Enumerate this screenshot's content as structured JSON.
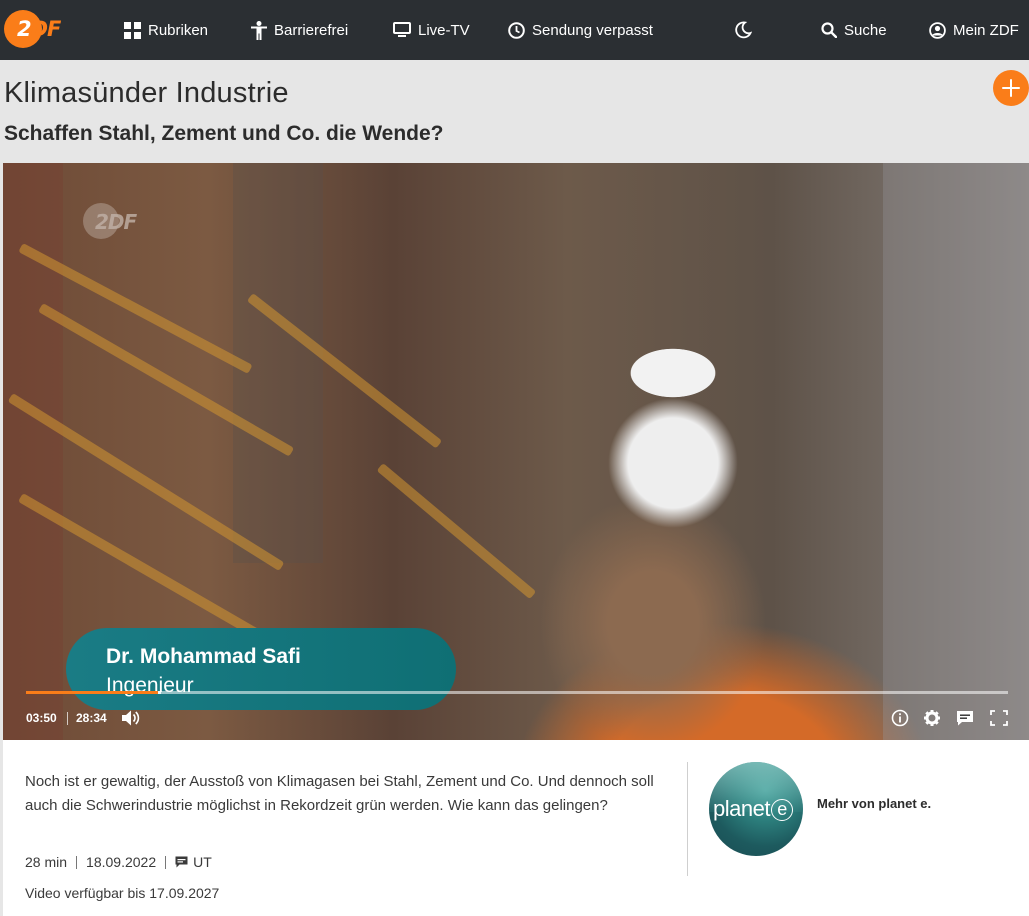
{
  "nav": {
    "logo_text_first": "2",
    "logo_text_rest": "DF",
    "items": [
      {
        "label": "Rubriken",
        "icon": "grid-icon"
      },
      {
        "label": "Barrierefrei",
        "icon": "accessibility-icon"
      },
      {
        "label": "Live-TV",
        "icon": "tv-icon"
      },
      {
        "label": "Sendung verpasst",
        "icon": "clock-icon"
      }
    ],
    "theme_icon": "moon-icon",
    "search_label": "Suche",
    "account_label": "Mein ZDF"
  },
  "page": {
    "title": "Klimasünder Industrie",
    "subtitle": "Schaffen Stahl, Zement und Co. die Wende?"
  },
  "player": {
    "watermark_first": "2",
    "watermark_rest": "DF",
    "lower_third_name": "Dr. Mohammad Safi",
    "lower_third_role": "Ingenieur",
    "current_time": "03:50",
    "duration": "28:34",
    "progress_fraction": 0.134,
    "buffer_fraction": 0.137,
    "accent_color": "#fa7d19"
  },
  "description": {
    "text": "Noch ist er gewaltig, der Ausstoß von Klimagasen bei Stahl, Zement und Co. Und dennoch soll auch die Schwerindustrie möglichst in Rekordzeit grün werden. Wie kann das gelingen?",
    "length": "28 min",
    "date": "18.09.2022",
    "subtitles": "UT",
    "availability": "Video verfügbar bis 17.09.2027"
  },
  "related": {
    "brand_text": "planet",
    "brand_mark": "e",
    "link_label": "Mehr von planet e."
  }
}
